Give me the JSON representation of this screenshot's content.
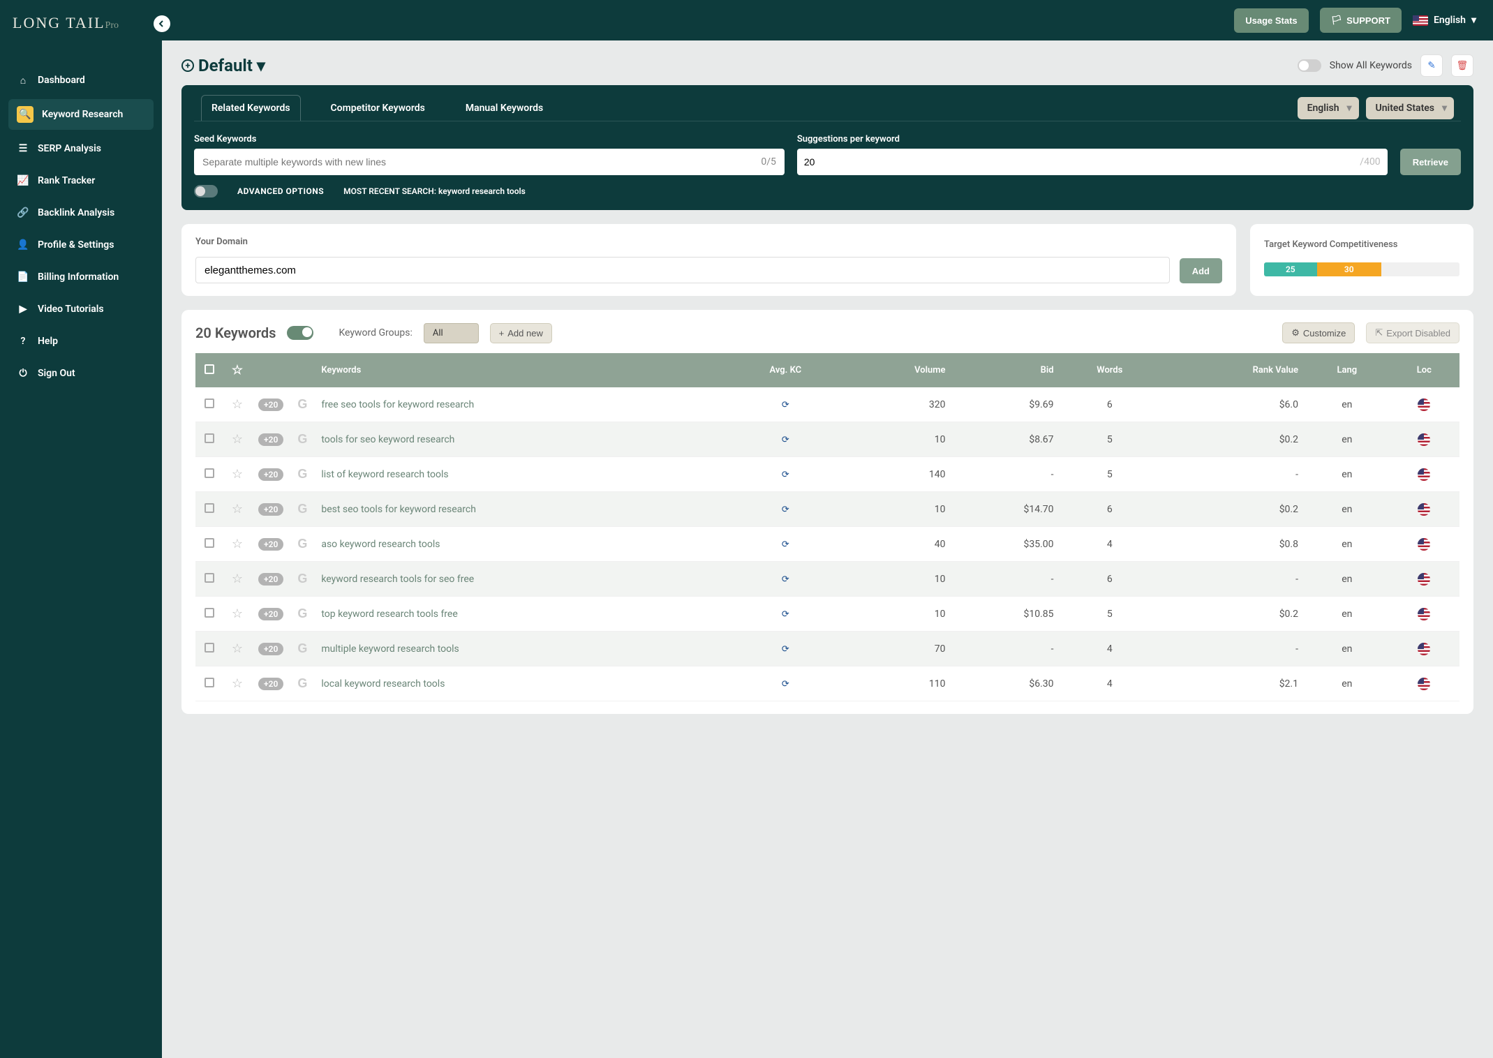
{
  "brand": {
    "name": "LONG TAIL",
    "suffix": "Pro"
  },
  "sidebar": {
    "items": [
      {
        "label": "Dashboard",
        "icon": "home"
      },
      {
        "label": "Keyword Research",
        "icon": "search",
        "active": true
      },
      {
        "label": "SERP Analysis",
        "icon": "list"
      },
      {
        "label": "Rank Tracker",
        "icon": "chart"
      },
      {
        "label": "Backlink Analysis",
        "icon": "link"
      },
      {
        "label": "Profile & Settings",
        "icon": "user"
      },
      {
        "label": "Billing Information",
        "icon": "file"
      },
      {
        "label": "Video Tutorials",
        "icon": "video"
      },
      {
        "label": "Help",
        "icon": "help"
      },
      {
        "label": "Sign Out",
        "icon": "power"
      }
    ]
  },
  "topbar": {
    "usage": "Usage Stats",
    "support": "SUPPORT",
    "lang": "English"
  },
  "project": {
    "name": "Default",
    "show_all": "Show All Keywords"
  },
  "tabs": {
    "related": "Related Keywords",
    "competitor": "Competitor Keywords",
    "manual": "Manual Keywords",
    "lang_dd": "English",
    "country_dd": "United States"
  },
  "search": {
    "seed_label": "Seed Keywords",
    "seed_placeholder": "Separate multiple keywords with new lines",
    "seed_count": "0/5",
    "sugg_label": "Suggestions per keyword",
    "sugg_value": "20",
    "sugg_max": "/400",
    "retrieve": "Retrieve",
    "advanced": "ADVANCED OPTIONS",
    "recent_label": "MOST RECENT SEARCH: ",
    "recent_value": "keyword research tools"
  },
  "domain": {
    "label": "Your Domain",
    "value": "elegantthemes.com",
    "add": "Add"
  },
  "comp": {
    "label": "Target Keyword Competitiveness",
    "v1": "25",
    "v2": "30"
  },
  "table": {
    "count": "20 Keywords",
    "groups_label": "Keyword Groups:",
    "groups_value": "All",
    "add_new": "Add new",
    "customize": "Customize",
    "export": "Export Disabled",
    "badge": "+20",
    "cols": {
      "kw": "Keywords",
      "kc": "Avg. KC",
      "vol": "Volume",
      "bid": "Bid",
      "words": "Words",
      "rank": "Rank Value",
      "lang": "Lang",
      "loc": "Loc"
    },
    "rows": [
      {
        "kw": "free seo tools for keyword research",
        "vol": "320",
        "bid": "$9.69",
        "words": "6",
        "rank": "$6.0",
        "lang": "en"
      },
      {
        "kw": "tools for seo keyword research",
        "vol": "10",
        "bid": "$8.67",
        "words": "5",
        "rank": "$0.2",
        "lang": "en"
      },
      {
        "kw": "list of keyword research tools",
        "vol": "140",
        "bid": "-",
        "words": "5",
        "rank": "-",
        "lang": "en"
      },
      {
        "kw": "best seo tools for keyword research",
        "vol": "10",
        "bid": "$14.70",
        "words": "6",
        "rank": "$0.2",
        "lang": "en"
      },
      {
        "kw": "aso keyword research tools",
        "vol": "40",
        "bid": "$35.00",
        "words": "4",
        "rank": "$0.8",
        "lang": "en"
      },
      {
        "kw": "keyword research tools for seo free",
        "vol": "10",
        "bid": "-",
        "words": "6",
        "rank": "-",
        "lang": "en"
      },
      {
        "kw": "top keyword research tools free",
        "vol": "10",
        "bid": "$10.85",
        "words": "5",
        "rank": "$0.2",
        "lang": "en"
      },
      {
        "kw": "multiple keyword research tools",
        "vol": "70",
        "bid": "-",
        "words": "4",
        "rank": "-",
        "lang": "en"
      },
      {
        "kw": "local keyword research tools",
        "vol": "110",
        "bid": "$6.30",
        "words": "4",
        "rank": "$2.1",
        "lang": "en"
      }
    ]
  }
}
